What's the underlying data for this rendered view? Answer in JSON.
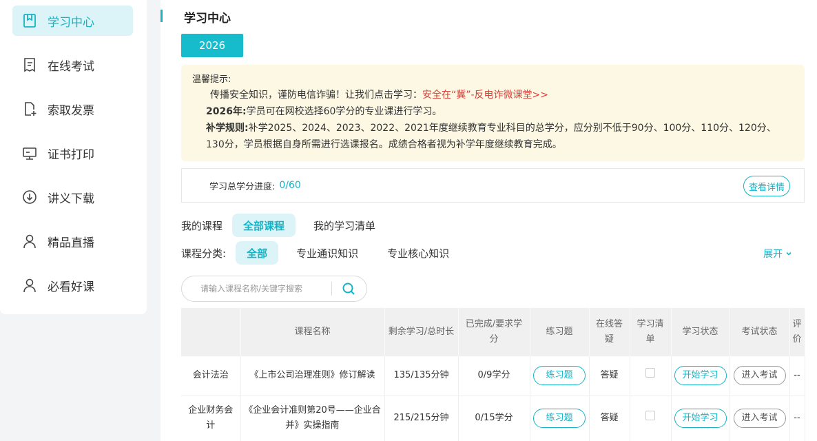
{
  "sidebar": {
    "items": [
      {
        "label": "学习中心",
        "icon": "book-icon",
        "active": true
      },
      {
        "label": "在线考试",
        "icon": "exam-icon",
        "active": false
      },
      {
        "label": "索取发票",
        "icon": "invoice-icon",
        "active": false
      },
      {
        "label": "证书打印",
        "icon": "monitor-icon",
        "active": false
      },
      {
        "label": "讲义下载",
        "icon": "download-icon",
        "active": false
      },
      {
        "label": "精品直播",
        "icon": "user-icon",
        "active": false
      },
      {
        "label": "必看好课",
        "icon": "user-icon",
        "active": false
      }
    ]
  },
  "page": {
    "title": "学习中心",
    "year_tab": "2026"
  },
  "tips": {
    "heading": "温馨提示:",
    "line1_text": "传播安全知识，谨防电信诈骗！让我们点击学习：",
    "line1_link": "安全在“冀”-反电诈微课堂>>",
    "line2_bold": "2026年:",
    "line2_text": "学员可在网校选择60学分的专业课进行学习。",
    "line3_bold": "补学规则:",
    "line3_text": "补学2025、2024、2023、2022、2021年度继续教育专业科目的总学分，应分别不低于90分、100分、110分、120分、130分，学员根据自身所需进行选课报名。成绩合格者视为补学年度继续教育完成。"
  },
  "progress": {
    "label": "学习总学分进度:",
    "value": "0/60",
    "detail_button": "查看详情"
  },
  "course_tabs": {
    "label": "我的课程",
    "items": [
      "全部课程",
      "我的学习清单"
    ]
  },
  "category": {
    "label": "课程分类:",
    "items": [
      "全部",
      "专业通识知识",
      "专业核心知识"
    ],
    "expand": "展开"
  },
  "search": {
    "placeholder": "请输入课程名称/关键字搜索"
  },
  "table": {
    "headers": [
      "",
      "课程名称",
      "剩余学习/总时长",
      "已完成/要求学分",
      "练习题",
      "在线答疑",
      "学习清单",
      "学习状态",
      "考试状态",
      "评价"
    ],
    "rows": [
      {
        "category": "会计法治",
        "name": "《上市公司治理准则》修订解读",
        "time": "135/135分钟",
        "credit": "0/9学分",
        "practice": "练习题",
        "qa": "答疑",
        "study": "开始学习",
        "exam": "进入考试",
        "rating": "--"
      },
      {
        "category": "企业财务会计",
        "name": "《企业会计准则第20号——企业合并》实操指南",
        "time": "215/215分钟",
        "credit": "0/15学分",
        "practice": "练习题",
        "qa": "答疑",
        "study": "开始学习",
        "exam": "进入考试",
        "rating": "--"
      }
    ]
  },
  "colors": {
    "accent": "#14b3c6",
    "tab_bg": "#16bccb",
    "notice_bg": "#fdf8e3",
    "link_red": "#d8403a"
  }
}
